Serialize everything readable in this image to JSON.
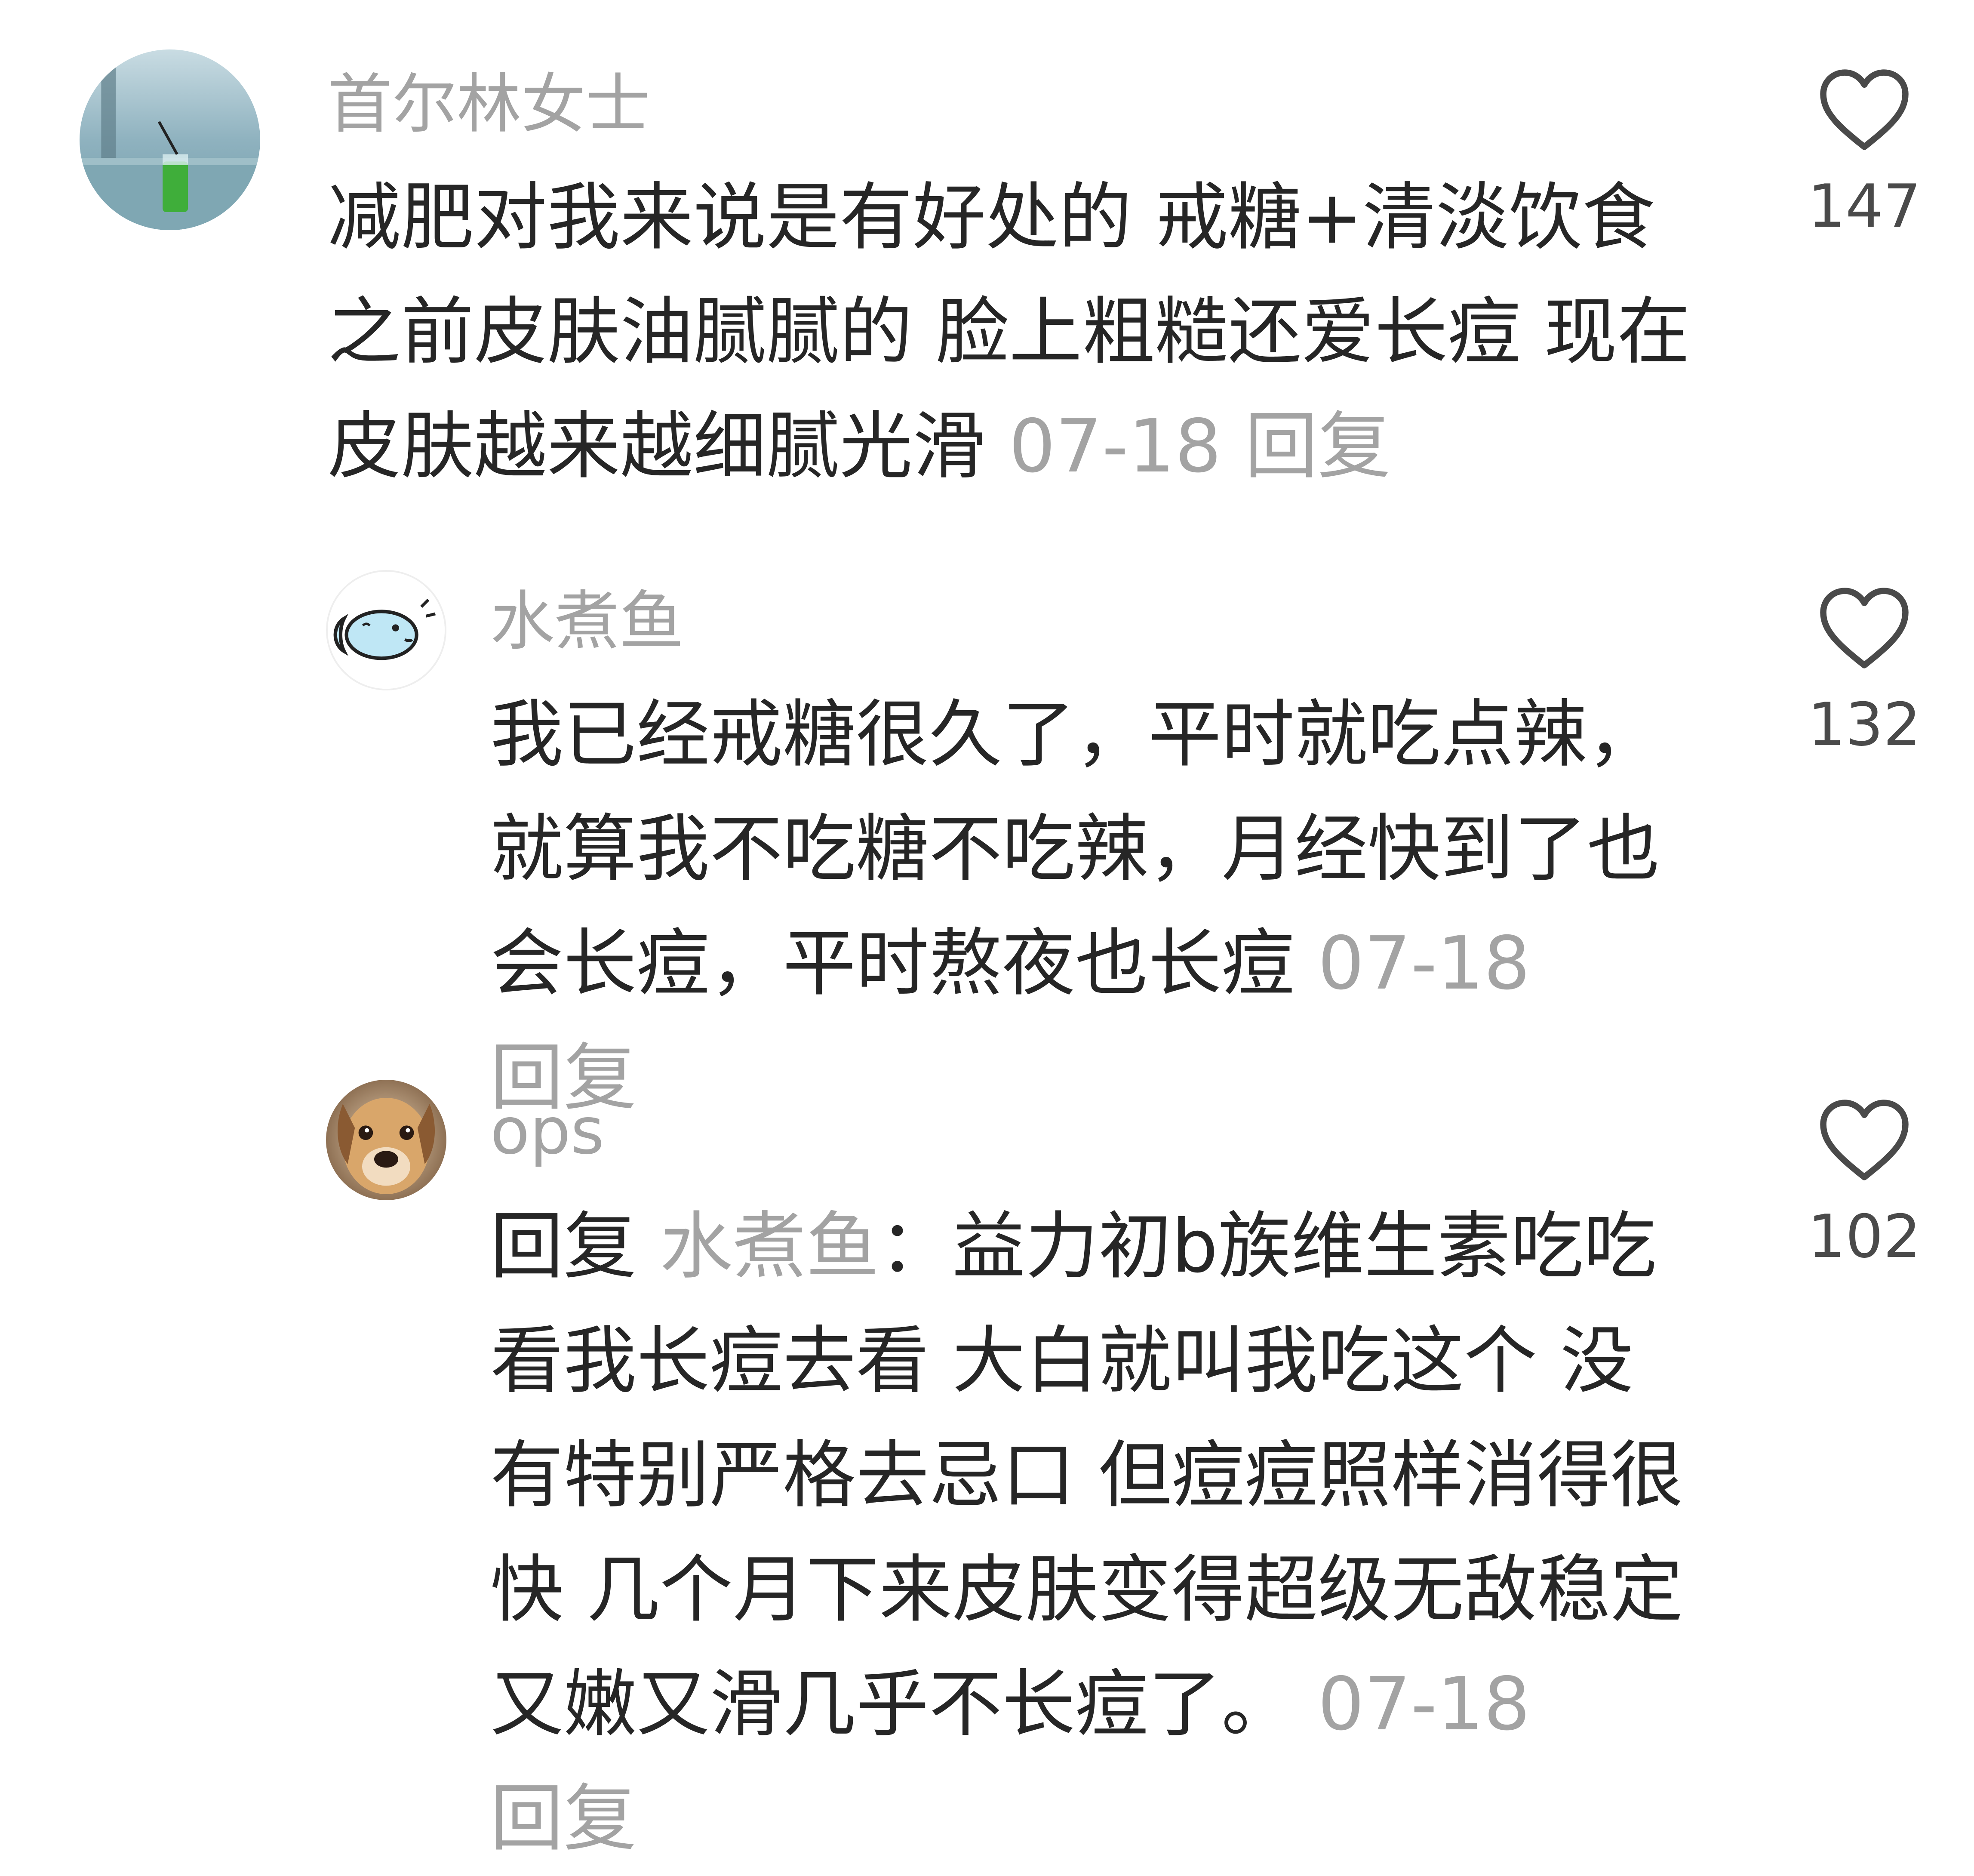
{
  "comments": [
    {
      "username": "首尔林女士",
      "text": "减肥对我来说是有好处的 戒糖+清淡饮食 之前皮肤油腻腻的 脸上粗糙还爱长痘 现在皮肤越来越细腻光滑",
      "date": "07-18",
      "reply_label": "回复",
      "likes": "147",
      "avatar_icon": "sea-view-drink-avatar"
    },
    {
      "username": "水煮鱼",
      "text": "我已经戒糖很久了，平时就吃点辣，就算我不吃糖不吃辣，月经快到了也会长痘，平时熬夜也长痘",
      "date": "07-18",
      "reply_label": "回复",
      "likes": "132",
      "avatar_icon": "cartoon-fish-avatar"
    },
    {
      "username": "ops",
      "reply_prefix": "回复",
      "reply_target": "水煮鱼",
      "reply_sep": "：",
      "text": "益力初b族维生素吃吃看我长痘去看 大白就叫我吃这个 没有特别严格去忌口 但痘痘照样消得很快 几个月下来皮肤变得超级无敌稳定 又嫩又滑几乎不长痘了。",
      "date": "07-18",
      "reply_label": "回复",
      "likes": "102",
      "avatar_icon": "dog-face-avatar"
    }
  ],
  "colors": {
    "username": "#a3a3a3",
    "body": "#262626",
    "meta": "#a3a3a3",
    "like_count": "#4a4a4a"
  }
}
